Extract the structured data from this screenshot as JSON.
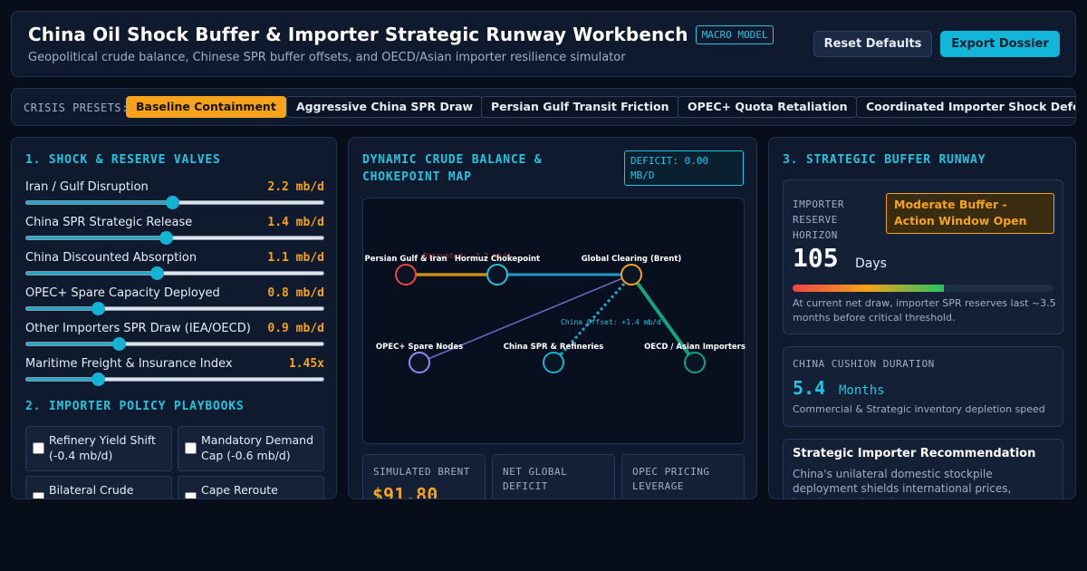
{
  "header": {
    "title": "China Oil Shock Buffer & Importer Strategic Runway Workbench",
    "badge": "MACRO MODEL",
    "subtitle": "Geopolitical crude balance, Chinese SPR buffer offsets, and OECD/Asian importer resilience simulator",
    "reset_label": "Reset Defaults",
    "export_label": "Export Dossier"
  },
  "presets": {
    "label": "CRISIS PRESETS:",
    "items": [
      {
        "label": "Baseline Containment",
        "active": true
      },
      {
        "label": "Aggressive China SPR Draw",
        "active": false
      },
      {
        "label": "Persian Gulf Transit Friction",
        "active": false
      },
      {
        "label": "OPEC+ Quota Retaliation",
        "active": false
      },
      {
        "label": "Coordinated Importer Shock Defense",
        "active": false
      }
    ]
  },
  "valves": {
    "title": "1. SHOCK & RESERVE VALVES",
    "sliders": [
      {
        "label": "Iran / Gulf Disruption",
        "value": "2.2 mb/d",
        "fraction": 0.49
      },
      {
        "label": "China SPR Strategic Release",
        "value": "1.4 mb/d",
        "fraction": 0.47
      },
      {
        "label": "China Discounted Absorption",
        "value": "1.1 mb/d",
        "fraction": 0.44
      },
      {
        "label": "OPEC+ Spare Capacity Deployed",
        "value": "0.8 mb/d",
        "fraction": 0.24
      },
      {
        "label": "Other Importers SPR Draw (IEA/OECD)",
        "value": "0.9 mb/d",
        "fraction": 0.31
      },
      {
        "label": "Maritime Freight & Insurance Index",
        "value": "1.45x",
        "fraction": 0.24
      }
    ]
  },
  "playbooks": {
    "title": "2. IMPORTER POLICY PLAYBOOKS",
    "items": [
      {
        "label": "Refinery Yield Shift (-0.4 mb/d)",
        "checked": false
      },
      {
        "label": "Mandatory Demand Cap (-0.6 mb/d)",
        "checked": false
      },
      {
        "label": "Bilateral Crude",
        "checked": false
      },
      {
        "label": "Cape Reroute",
        "checked": false
      }
    ]
  },
  "map": {
    "title": "DYNAMIC CRUDE BALANCE & CHOKEPOINT MAP",
    "deficit_badge": "DEFICIT: 0.00 MB/D",
    "nodes": {
      "gulf": "Persian Gulf & Iran",
      "hormuz": "Hormuz Chokepoint",
      "brent": "Global Clearing (Brent)",
      "opec": "OPEC+ Spare Nodes",
      "china": "China SPR & Refineries",
      "oecd": "OECD / Asian Importers"
    },
    "flow_labels": {
      "disrupted": "Disrupted: -2.2 mb/d",
      "china_offset": "China Offset: +1.4 mb/d"
    },
    "colors": {
      "gulf": "#ef4444",
      "hormuz": "#22c4e0",
      "brent": "#f5a31a",
      "opec": "#8b8cf0",
      "china": "#14b3d4",
      "oecd": "#14a37f"
    }
  },
  "metrics": [
    {
      "label": "SIMULATED BRENT",
      "value": "$91.80"
    },
    {
      "label": "NET GLOBAL DEFICIT",
      "value": ""
    },
    {
      "label": "OPEC PRICING LEVERAGE",
      "value": ""
    }
  ],
  "runway": {
    "title": "3. STRATEGIC BUFFER RUNWAY",
    "horizon_label": "IMPORTER RESERVE HORIZON",
    "status": "Moderate Buffer - Action Window Open",
    "days_value": "105",
    "days_unit": "Days",
    "bar_fraction": 0.58,
    "horizon_note": "At current net draw, importer SPR reserves last ~3.5 months before critical threshold.",
    "cushion_label": "CHINA CUSHION DURATION",
    "cushion_value": "5.4",
    "cushion_unit": "Months",
    "cushion_note": "Commercial & Strategic inventory depletion speed",
    "rec_title": "Strategic Importer Recommendation",
    "rec_text": "China's unilateral domestic stockpile deployment shields international prices, keeping crude under"
  }
}
